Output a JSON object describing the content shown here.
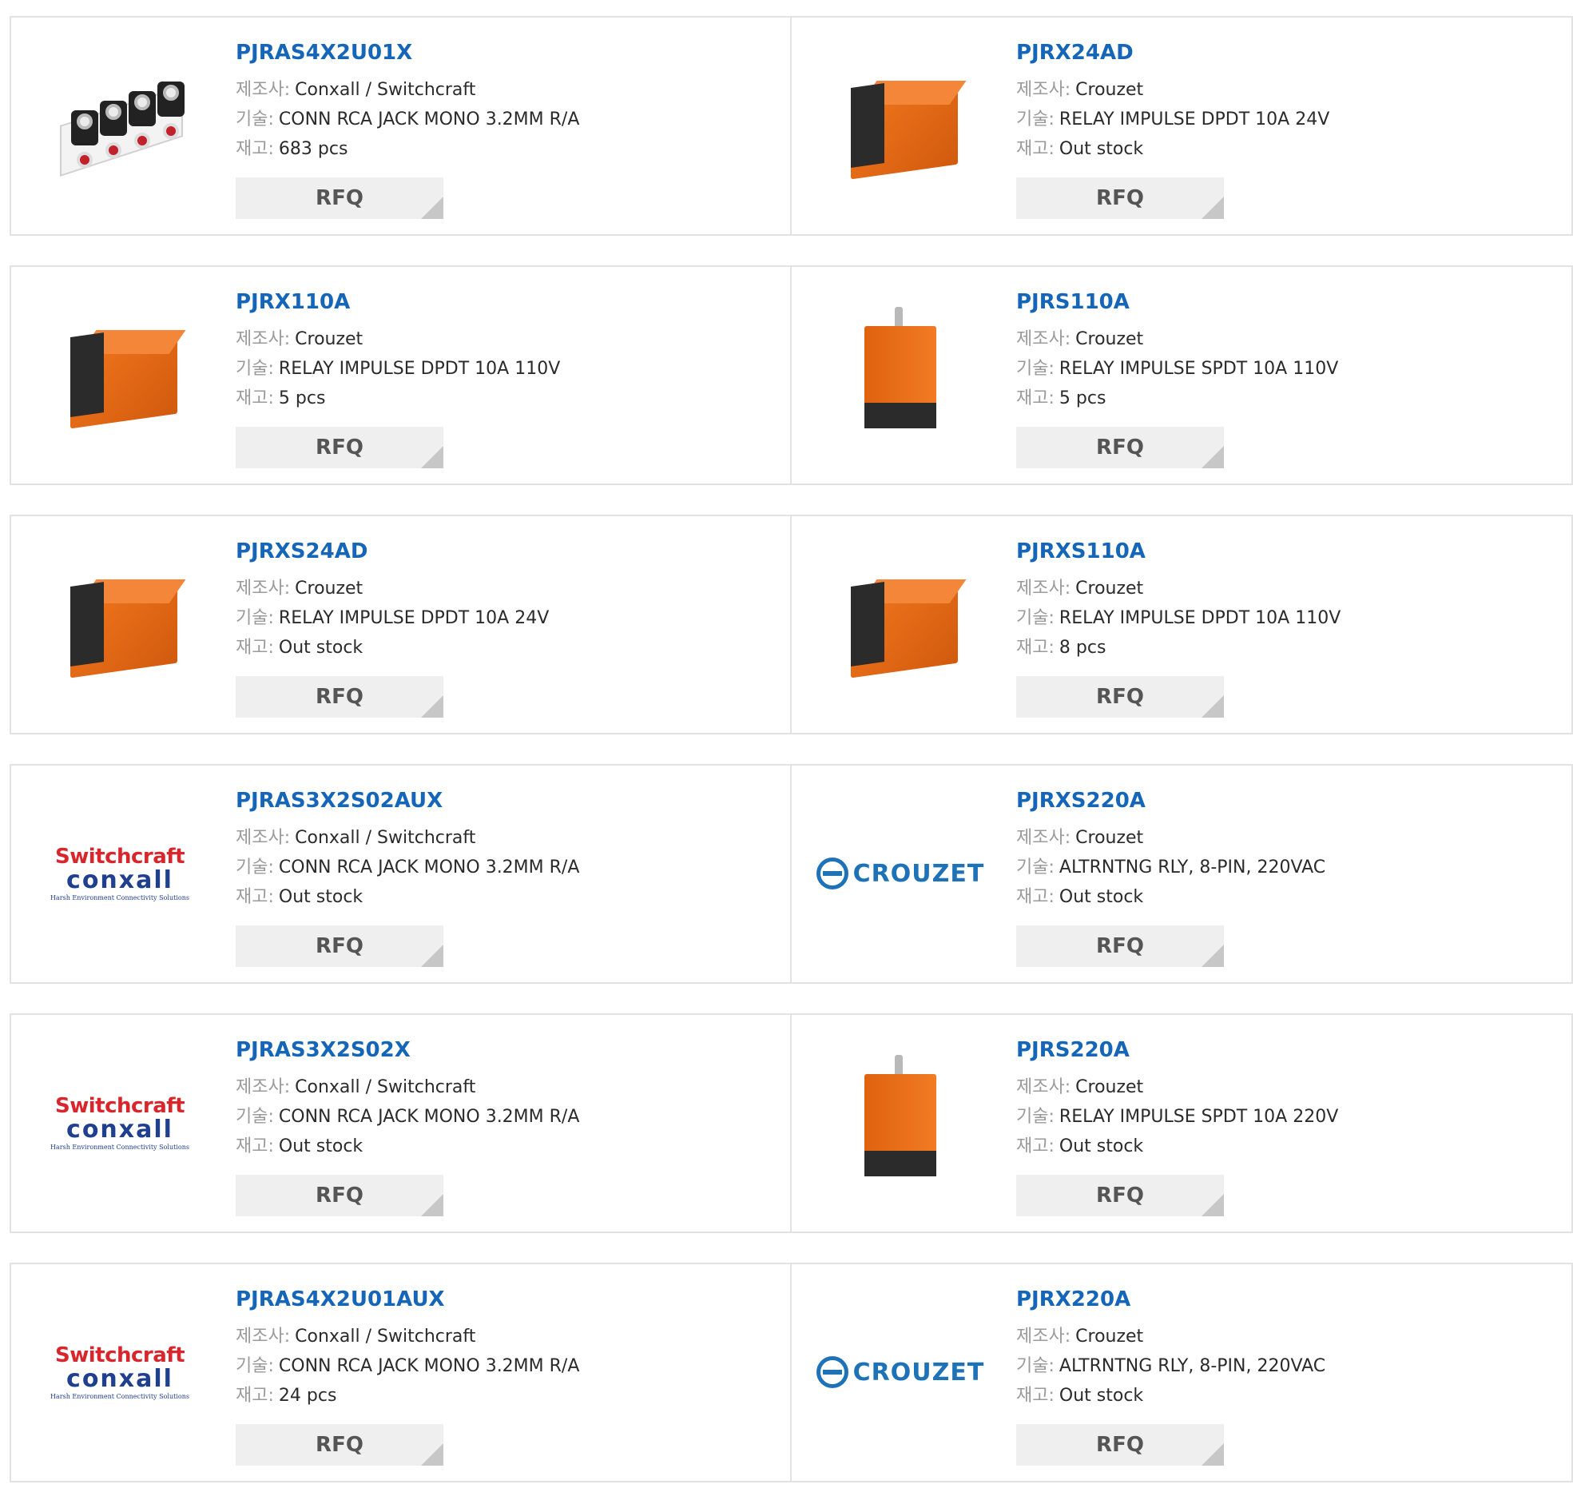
{
  "labels": {
    "manufacturer": "제조사:",
    "description": "기술:",
    "stock": "재고:"
  },
  "rfq_label": "RFQ",
  "logos": {
    "switchcraft_top": "Switchcraft",
    "switchcraft_bottom": "conxall",
    "switchcraft_tagline": "Harsh Environment Connectivity Solutions",
    "crouzet": "CROUZET"
  },
  "colors": {
    "part_number": "#1565b8",
    "relay_orange": "#e8691a",
    "rfq_bg": "#efefef"
  },
  "products": [
    {
      "pn": "PJRAS4X2U01X",
      "mfr": "Conxall / Switchcraft",
      "desc": "CONN RCA JACK MONO 3.2MM R/A",
      "stock": "683 pcs",
      "image": "rca-jack-photo"
    },
    {
      "pn": "PJRX24AD",
      "mfr": "Crouzet",
      "desc": "RELAY IMPULSE DPDT 10A 24V",
      "stock": "Out stock",
      "image": "relay-photo"
    },
    {
      "pn": "PJRX110A",
      "mfr": "Crouzet",
      "desc": "RELAY IMPULSE DPDT 10A 110V",
      "stock": "5 pcs",
      "image": "relay-photo"
    },
    {
      "pn": "PJRS110A",
      "mfr": "Crouzet",
      "desc": "RELAY IMPULSE SPDT 10A 110V",
      "stock": "5 pcs",
      "image": "relay-vertical-photo"
    },
    {
      "pn": "PJRXS24AD",
      "mfr": "Crouzet",
      "desc": "RELAY IMPULSE DPDT 10A 24V",
      "stock": "Out stock",
      "image": "relay-photo"
    },
    {
      "pn": "PJRXS110A",
      "mfr": "Crouzet",
      "desc": "RELAY IMPULSE DPDT 10A 110V",
      "stock": "8 pcs",
      "image": "relay-photo"
    },
    {
      "pn": "PJRAS3X2S02AUX",
      "mfr": "Conxall / Switchcraft",
      "desc": "CONN RCA JACK MONO 3.2MM R/A",
      "stock": "Out stock",
      "image": "switchcraft-logo"
    },
    {
      "pn": "PJRXS220A",
      "mfr": "Crouzet",
      "desc": "ALTRNTNG RLY, 8-PIN, 220VAC",
      "stock": "Out stock",
      "image": "crouzet-logo"
    },
    {
      "pn": "PJRAS3X2S02X",
      "mfr": "Conxall / Switchcraft",
      "desc": "CONN RCA JACK MONO 3.2MM R/A",
      "stock": "Out stock",
      "image": "switchcraft-logo"
    },
    {
      "pn": "PJRS220A",
      "mfr": "Crouzet",
      "desc": "RELAY IMPULSE SPDT 10A 220V",
      "stock": "Out stock",
      "image": "relay-vertical-photo"
    },
    {
      "pn": "PJRAS4X2U01AUX",
      "mfr": "Conxall / Switchcraft",
      "desc": "CONN RCA JACK MONO 3.2MM R/A",
      "stock": "24 pcs",
      "image": "switchcraft-logo"
    },
    {
      "pn": "PJRX220A",
      "mfr": "Crouzet",
      "desc": "ALTRNTNG RLY, 8-PIN, 220VAC",
      "stock": "Out stock",
      "image": "crouzet-logo"
    }
  ]
}
